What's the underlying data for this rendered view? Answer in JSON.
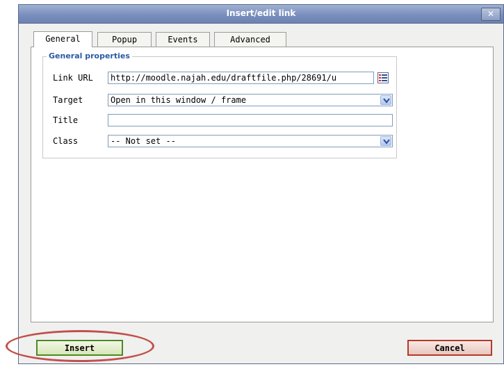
{
  "dialog": {
    "title": "Insert/edit link",
    "close_glyph": "✕"
  },
  "tabs": [
    {
      "label": "General",
      "active": true
    },
    {
      "label": "Popup",
      "active": false
    },
    {
      "label": "Events",
      "active": false
    },
    {
      "label": "Advanced",
      "active": false
    }
  ],
  "general": {
    "legend": "General properties",
    "link_url_label": "Link URL",
    "link_url_value": "http://moodle.najah.edu/draftfile.php/28691/u",
    "target_label": "Target",
    "target_value": "Open in this window / frame",
    "title_label": "Title",
    "title_value": "",
    "class_label": "Class",
    "class_value": "-- Not set --"
  },
  "buttons": {
    "insert": "Insert",
    "cancel": "Cancel"
  },
  "colors": {
    "titlebar": "#7a8fbd",
    "legend": "#2b5aa6",
    "insert_border": "#4b8a26",
    "cancel_border": "#b33a2a",
    "annotation": "#c0504d"
  },
  "icons": {
    "browse": "browse-list-icon",
    "dropdown": "chevron-down-icon",
    "close": "close-icon"
  }
}
